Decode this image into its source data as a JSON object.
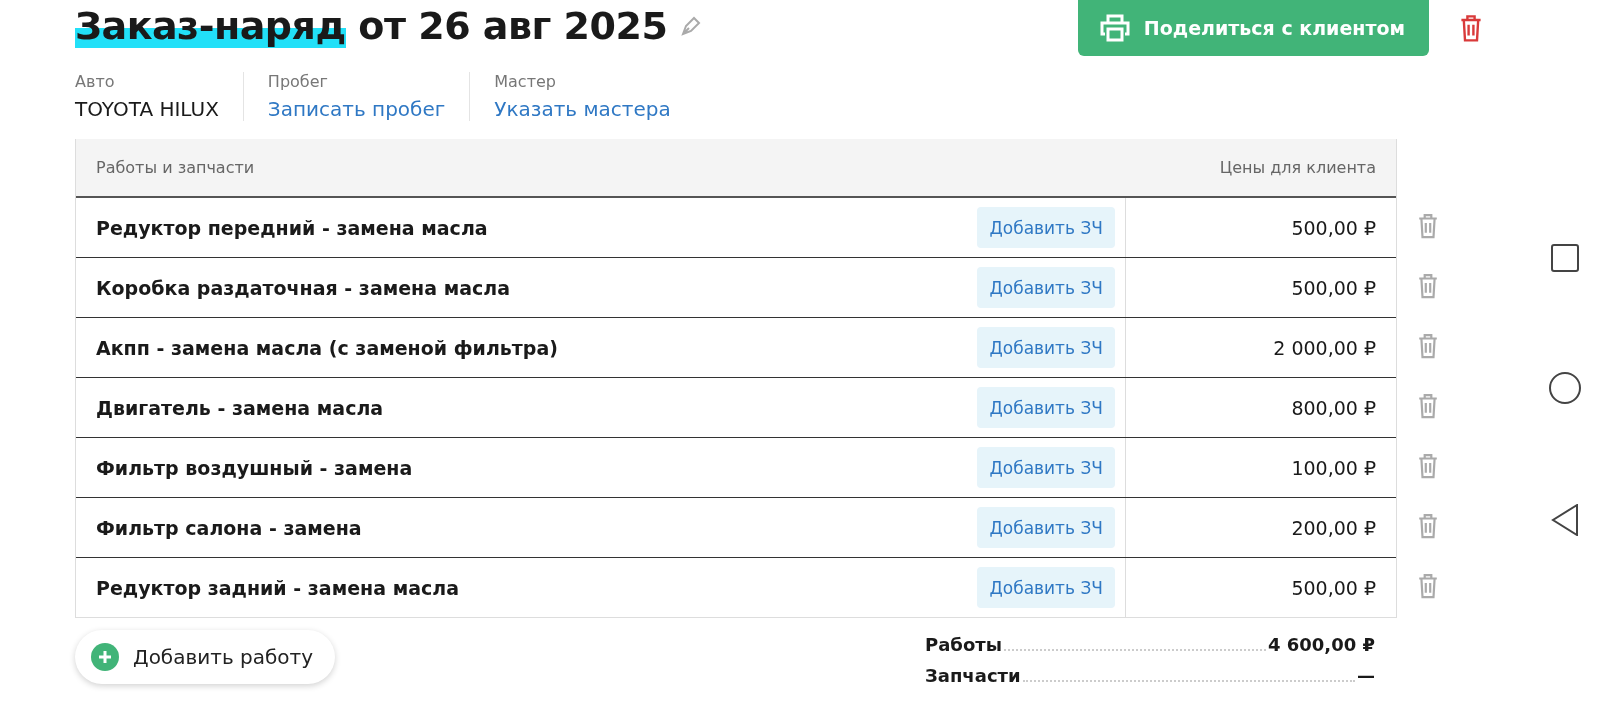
{
  "title": {
    "highlighted": "Заказ-наряд",
    "rest": "от 26 авг 2025"
  },
  "share_button": "Поделиться с клиентом",
  "info": [
    {
      "label": "Авто",
      "value": "TOYOTA HILUX",
      "kind": "text"
    },
    {
      "label": "Пробег",
      "value": "Записать пробег",
      "kind": "link"
    },
    {
      "label": "Мастер",
      "value": "Указать мастера",
      "kind": "link"
    }
  ],
  "table": {
    "columns": [
      "Работы и запчасти",
      "Цены для клиента"
    ],
    "rows": [
      {
        "name": "Редуктор передний - замена масла",
        "action": "Добавить ЗЧ",
        "price": "500,00 ₽"
      },
      {
        "name": "Коробка раздаточная - замена масла",
        "action": "Добавить ЗЧ",
        "price": "500,00 ₽"
      },
      {
        "name": "Акпп - замена масла (с заменой фильтра)",
        "action": "Добавить ЗЧ",
        "price": "2 000,00 ₽"
      },
      {
        "name": "Двигатель - замена масла",
        "action": "Добавить ЗЧ",
        "price": "800,00 ₽"
      },
      {
        "name": "Фильтр воздушный - замена",
        "action": "Добавить ЗЧ",
        "price": "100,00 ₽"
      },
      {
        "name": "Фильтр салона - замена",
        "action": "Добавить ЗЧ",
        "price": "200,00 ₽"
      },
      {
        "name": "Редуктор задний - замена масла",
        "action": "Добавить ЗЧ",
        "price": "500,00 ₽"
      }
    ]
  },
  "add_work_button": "Добавить работу",
  "totals": [
    {
      "label": "Работы",
      "value": "4 600,00 ₽"
    },
    {
      "label": "Запчасти",
      "value": "—"
    }
  ]
}
